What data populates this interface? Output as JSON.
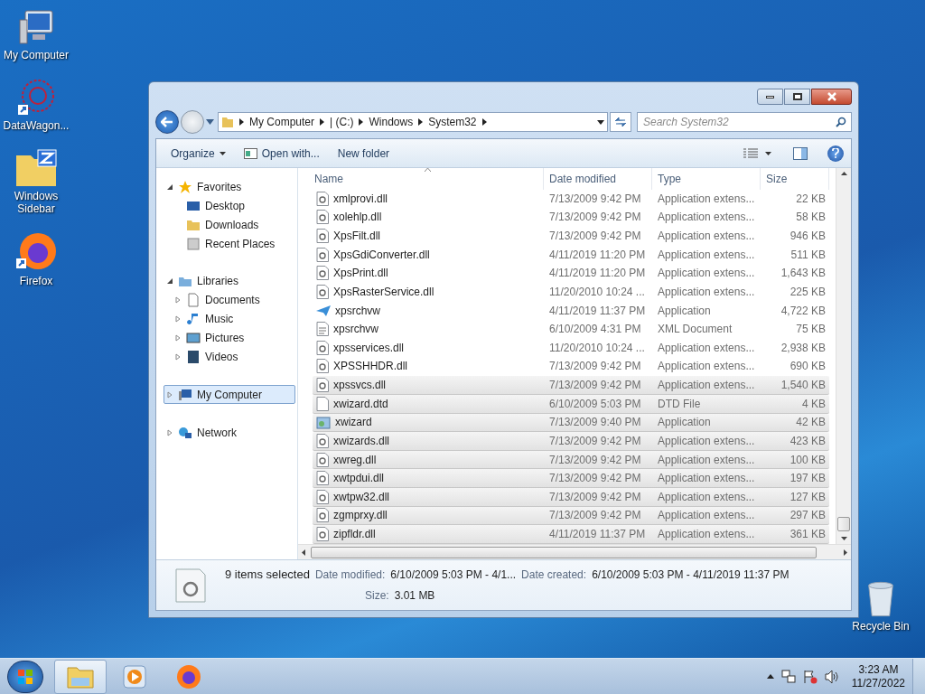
{
  "desktop_icons": [
    {
      "label": "My Computer",
      "kind": "computer"
    },
    {
      "label": "DataWagon...",
      "kind": "web"
    },
    {
      "label": "Windows Sidebar",
      "kind": "zip"
    },
    {
      "label": "Firefox",
      "kind": "firefox"
    }
  ],
  "recycle_bin": {
    "label": "Recycle Bin"
  },
  "window": {
    "address": [
      "My Computer",
      "| (C:)",
      "Windows",
      "System32"
    ],
    "search": {
      "placeholder": "Search System32"
    }
  },
  "toolbar": [
    "Organize",
    "Open with...",
    "New folder"
  ],
  "nav": [
    {
      "label": "Favorites",
      "kind": "star",
      "expanded": true,
      "children": [
        {
          "label": "Desktop",
          "kind": "desktop"
        },
        {
          "label": "Downloads",
          "kind": "downloads"
        },
        {
          "label": "Recent Places",
          "kind": "recent"
        }
      ]
    },
    {
      "label": "Libraries",
      "kind": "library",
      "expanded": true,
      "children": [
        {
          "label": "Documents",
          "kind": "documents",
          "expanded": false
        },
        {
          "label": "Music",
          "kind": "music",
          "expanded": false
        },
        {
          "label": "Pictures",
          "kind": "pictures",
          "expanded": false
        },
        {
          "label": "Videos",
          "kind": "videos",
          "expanded": false
        }
      ]
    },
    {
      "label": "My Computer",
      "kind": "computer",
      "expanded": false,
      "selected": true
    },
    {
      "label": "Network",
      "kind": "network",
      "expanded": false,
      "selected": false
    }
  ],
  "table": {
    "columns": [
      "Name",
      "Date modified",
      "Type",
      "Size"
    ],
    "rows": [
      {
        "name": "xmlprovi.dll",
        "date": "7/13/2009 9:42 PM",
        "type": "Application extens...",
        "size": "22 KB",
        "kind": "dll",
        "selected": false
      },
      {
        "name": "xolehlp.dll",
        "date": "7/13/2009 9:42 PM",
        "type": "Application extens...",
        "size": "58 KB",
        "kind": "dll",
        "selected": false
      },
      {
        "name": "XpsFilt.dll",
        "date": "7/13/2009 9:42 PM",
        "type": "Application extens...",
        "size": "946 KB",
        "kind": "dll",
        "selected": false
      },
      {
        "name": "XpsGdiConverter.dll",
        "date": "4/11/2019 11:20 PM",
        "type": "Application extens...",
        "size": "511 KB",
        "kind": "dll",
        "selected": false
      },
      {
        "name": "XpsPrint.dll",
        "date": "4/11/2019 11:20 PM",
        "type": "Application extens...",
        "size": "1,643 KB",
        "kind": "dll",
        "selected": false
      },
      {
        "name": "XpsRasterService.dll",
        "date": "11/20/2010 10:24 ...",
        "type": "Application extens...",
        "size": "225 KB",
        "kind": "dll",
        "selected": false
      },
      {
        "name": "xpsrchvw",
        "date": "4/11/2019 11:37 PM",
        "type": "Application",
        "size": "4,722 KB",
        "kind": "app",
        "selected": false
      },
      {
        "name": "xpsrchvw",
        "date": "6/10/2009 4:31 PM",
        "type": "XML Document",
        "size": "75 KB",
        "kind": "xml",
        "selected": false
      },
      {
        "name": "xpsservices.dll",
        "date": "11/20/2010 10:24 ...",
        "type": "Application extens...",
        "size": "2,938 KB",
        "kind": "dll",
        "selected": false
      },
      {
        "name": "XPSSHHDR.dll",
        "date": "7/13/2009 9:42 PM",
        "type": "Application extens...",
        "size": "690 KB",
        "kind": "dll",
        "selected": false
      },
      {
        "name": "xpssvcs.dll",
        "date": "7/13/2009 9:42 PM",
        "type": "Application extens...",
        "size": "1,540 KB",
        "kind": "dll",
        "selected": true
      },
      {
        "name": "xwizard.dtd",
        "date": "6/10/2009 5:03 PM",
        "type": "DTD File",
        "size": "4 KB",
        "kind": "file",
        "selected": true
      },
      {
        "name": "xwizard",
        "date": "7/13/2009 9:40 PM",
        "type": "Application",
        "size": "42 KB",
        "kind": "wizard",
        "selected": true
      },
      {
        "name": "xwizards.dll",
        "date": "7/13/2009 9:42 PM",
        "type": "Application extens...",
        "size": "423 KB",
        "kind": "dll",
        "selected": true
      },
      {
        "name": "xwreg.dll",
        "date": "7/13/2009 9:42 PM",
        "type": "Application extens...",
        "size": "100 KB",
        "kind": "dll",
        "selected": true
      },
      {
        "name": "xwtpdui.dll",
        "date": "7/13/2009 9:42 PM",
        "type": "Application extens...",
        "size": "197 KB",
        "kind": "dll",
        "selected": true
      },
      {
        "name": "xwtpw32.dll",
        "date": "7/13/2009 9:42 PM",
        "type": "Application extens...",
        "size": "127 KB",
        "kind": "dll",
        "selected": true
      },
      {
        "name": "zgmprxy.dll",
        "date": "7/13/2009 9:42 PM",
        "type": "Application extens...",
        "size": "297 KB",
        "kind": "dll",
        "selected": true
      },
      {
        "name": "zipfldr.dll",
        "date": "4/11/2019 11:37 PM",
        "type": "Application extens...",
        "size": "361 KB",
        "kind": "dll",
        "selected": true
      }
    ]
  },
  "details": {
    "summary": "9 items selected",
    "fields": [
      {
        "label": "Date modified:",
        "value": "6/10/2009 5:03 PM - 4/1..."
      },
      {
        "label": "Date created:",
        "value": "6/10/2009 5:03 PM - 4/11/2019 11:37 PM"
      },
      {
        "label": "Size:",
        "value": "3.01 MB"
      }
    ]
  },
  "taskbar": {
    "apps": [
      {
        "kind": "explorer",
        "selected": true
      },
      {
        "kind": "media",
        "selected": false
      },
      {
        "kind": "firefox",
        "selected": false
      }
    ],
    "time": "3:23 AM",
    "date": "11/27/2022"
  }
}
